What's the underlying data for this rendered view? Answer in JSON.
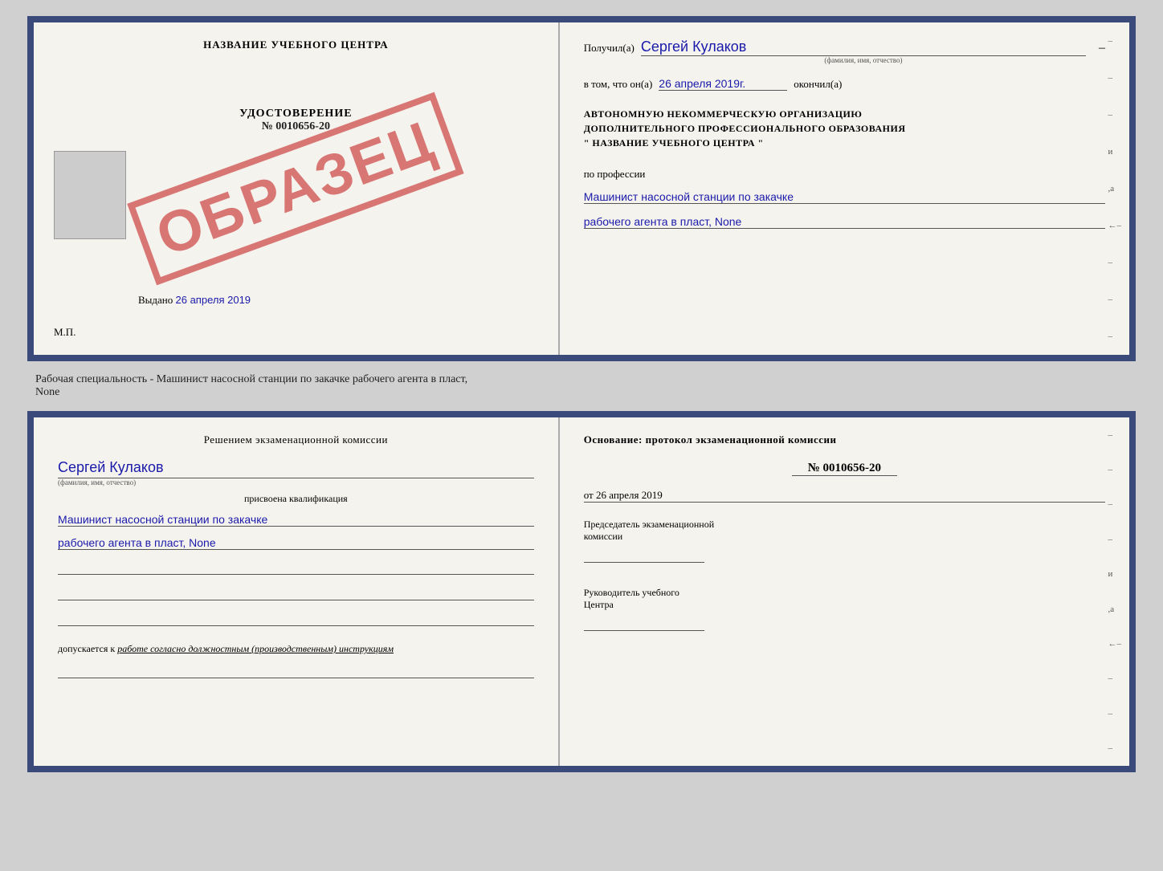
{
  "top_doc": {
    "left": {
      "title": "НАЗВАНИЕ УЧЕБНОГО ЦЕНТРА",
      "cert_title": "УДОСТОВЕРЕНИЕ",
      "cert_number": "№ 0010656-20",
      "vydano_label": "Выдано",
      "vydano_date": "26 апреля 2019",
      "mp_label": "М.П.",
      "stamp_text": "ОБРАЗЕЦ"
    },
    "right": {
      "received_label": "Получил(а)",
      "received_name": "Сергей Кулаков",
      "name_sub": "(фамилия, имя, отчество)",
      "in_that_label": "в том, что он(а)",
      "date_value": "26 апреля 2019г.",
      "finished_label": "окончил(а)",
      "org_line1": "АВТОНОМНУЮ НЕКОММЕРЧЕСКУЮ ОРГАНИЗАЦИЮ",
      "org_line2": "ДОПОЛНИТЕЛЬНОГО ПРОФЕССИОНАЛЬНОГО ОБРАЗОВАНИЯ",
      "org_line3": "\"  НАЗВАНИЕ УЧЕБНОГО ЦЕНТРА  \"",
      "by_profession": "по профессии",
      "profession_line1": "Машинист насосной станции по закачке",
      "profession_line2": "рабочего агента в пласт, None",
      "dashes": [
        "-",
        "-",
        "-",
        "и",
        "а",
        "←",
        "-",
        "-",
        "-",
        "-"
      ]
    }
  },
  "middle": {
    "text": "Рабочая специальность - Машинист насосной станции по закачке рабочего агента в пласт,",
    "text2": "None"
  },
  "bottom_doc": {
    "left": {
      "komissia_title": "Решением экзаменационной комиссии",
      "name": "Сергей Кулаков",
      "name_sub": "(фамилия, имя, отчество)",
      "prisvoyena": "присвоена квалификация",
      "qual_line1": "Машинист насосной станции по закачке",
      "qual_line2": "рабочего агента в пласт, None",
      "dopuskaetsya_label": "допускается к",
      "dopuskaetsya_value": "работе согласно должностным (производственным) инструкциям"
    },
    "right": {
      "osnovaniye_label": "Основание: протокол экзаменационной комиссии",
      "protocol_num": "№ 0010656-20",
      "ot_label": "от",
      "ot_date": "26 апреля 2019",
      "chairman_line1": "Председатель экзаменационной",
      "chairman_line2": "комиссии",
      "rukovoditel_line1": "Руководитель учебного",
      "rukovoditel_line2": "Центра",
      "dashes": [
        "-",
        "-",
        "-",
        "-",
        "и",
        "а",
        "←",
        "-",
        "-",
        "-",
        "-"
      ]
    }
  }
}
